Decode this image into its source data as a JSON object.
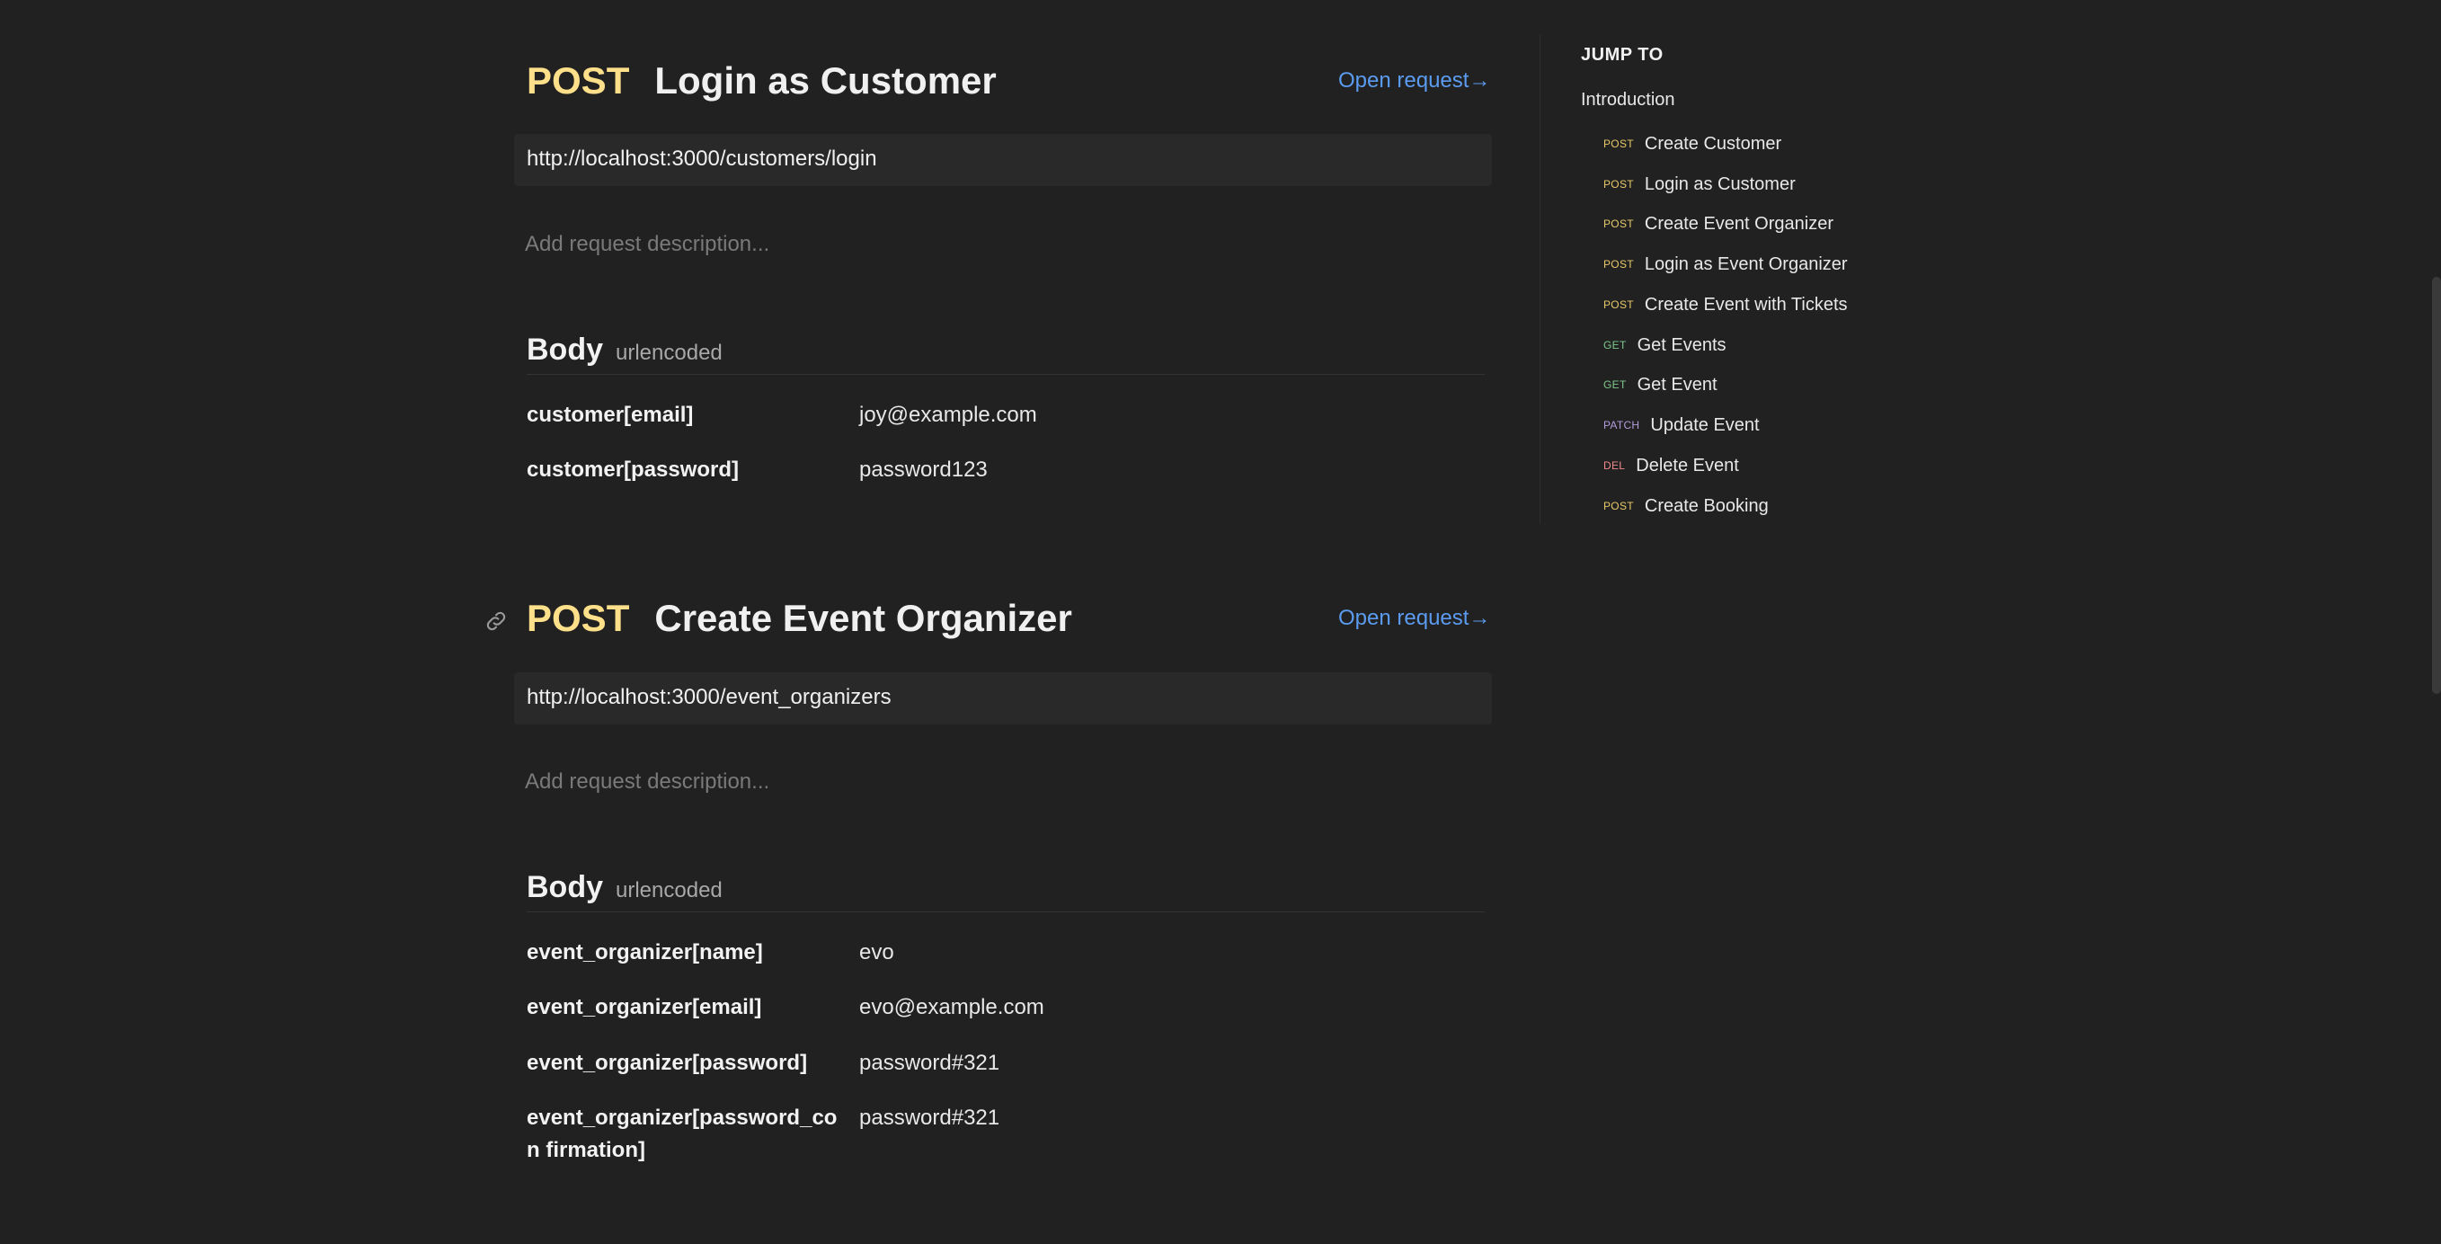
{
  "requests": [
    {
      "method": "POST",
      "title": "Login as Customer",
      "open_label": "Open request→",
      "url": "http://localhost:3000/customers/login",
      "description_placeholder": "Add request description...",
      "body_title": "Body",
      "body_type": "urlencoded",
      "params": [
        {
          "key": "customer[email]",
          "value": "joy@example.com"
        },
        {
          "key": "customer[password]",
          "value": "password123"
        }
      ]
    },
    {
      "method": "POST",
      "title": "Create Event Organizer",
      "open_label": "Open request→",
      "url": "http://localhost:3000/event_organizers",
      "description_placeholder": "Add request description...",
      "body_title": "Body",
      "body_type": "urlencoded",
      "params": [
        {
          "key": "event_organizer[name]",
          "value": "evo"
        },
        {
          "key": "event_organizer[email]",
          "value": "evo@example.com"
        },
        {
          "key": "event_organizer[password]",
          "value": "password#321"
        },
        {
          "key": "event_organizer[password_con firmation]",
          "value": "password#321"
        }
      ]
    }
  ],
  "sidebar": {
    "heading": "JUMP TO",
    "intro": "Introduction",
    "items": [
      {
        "method": "POST",
        "label": "Create Customer"
      },
      {
        "method": "POST",
        "label": "Login as Customer"
      },
      {
        "method": "POST",
        "label": "Create Event Organizer"
      },
      {
        "method": "POST",
        "label": "Login as Event Organizer"
      },
      {
        "method": "POST",
        "label": "Create Event with Tickets"
      },
      {
        "method": "GET",
        "label": "Get Events"
      },
      {
        "method": "GET",
        "label": "Get Event"
      },
      {
        "method": "PATCH",
        "label": "Update Event"
      },
      {
        "method": "DEL",
        "label": "Delete Event"
      },
      {
        "method": "POST",
        "label": "Create Booking"
      }
    ]
  },
  "colors": {
    "background": "#212121",
    "post": "#ffe08a",
    "link": "#5b9bf0",
    "get": "#7ec88a",
    "patch": "#b39ddb",
    "del": "#f08a8a"
  }
}
